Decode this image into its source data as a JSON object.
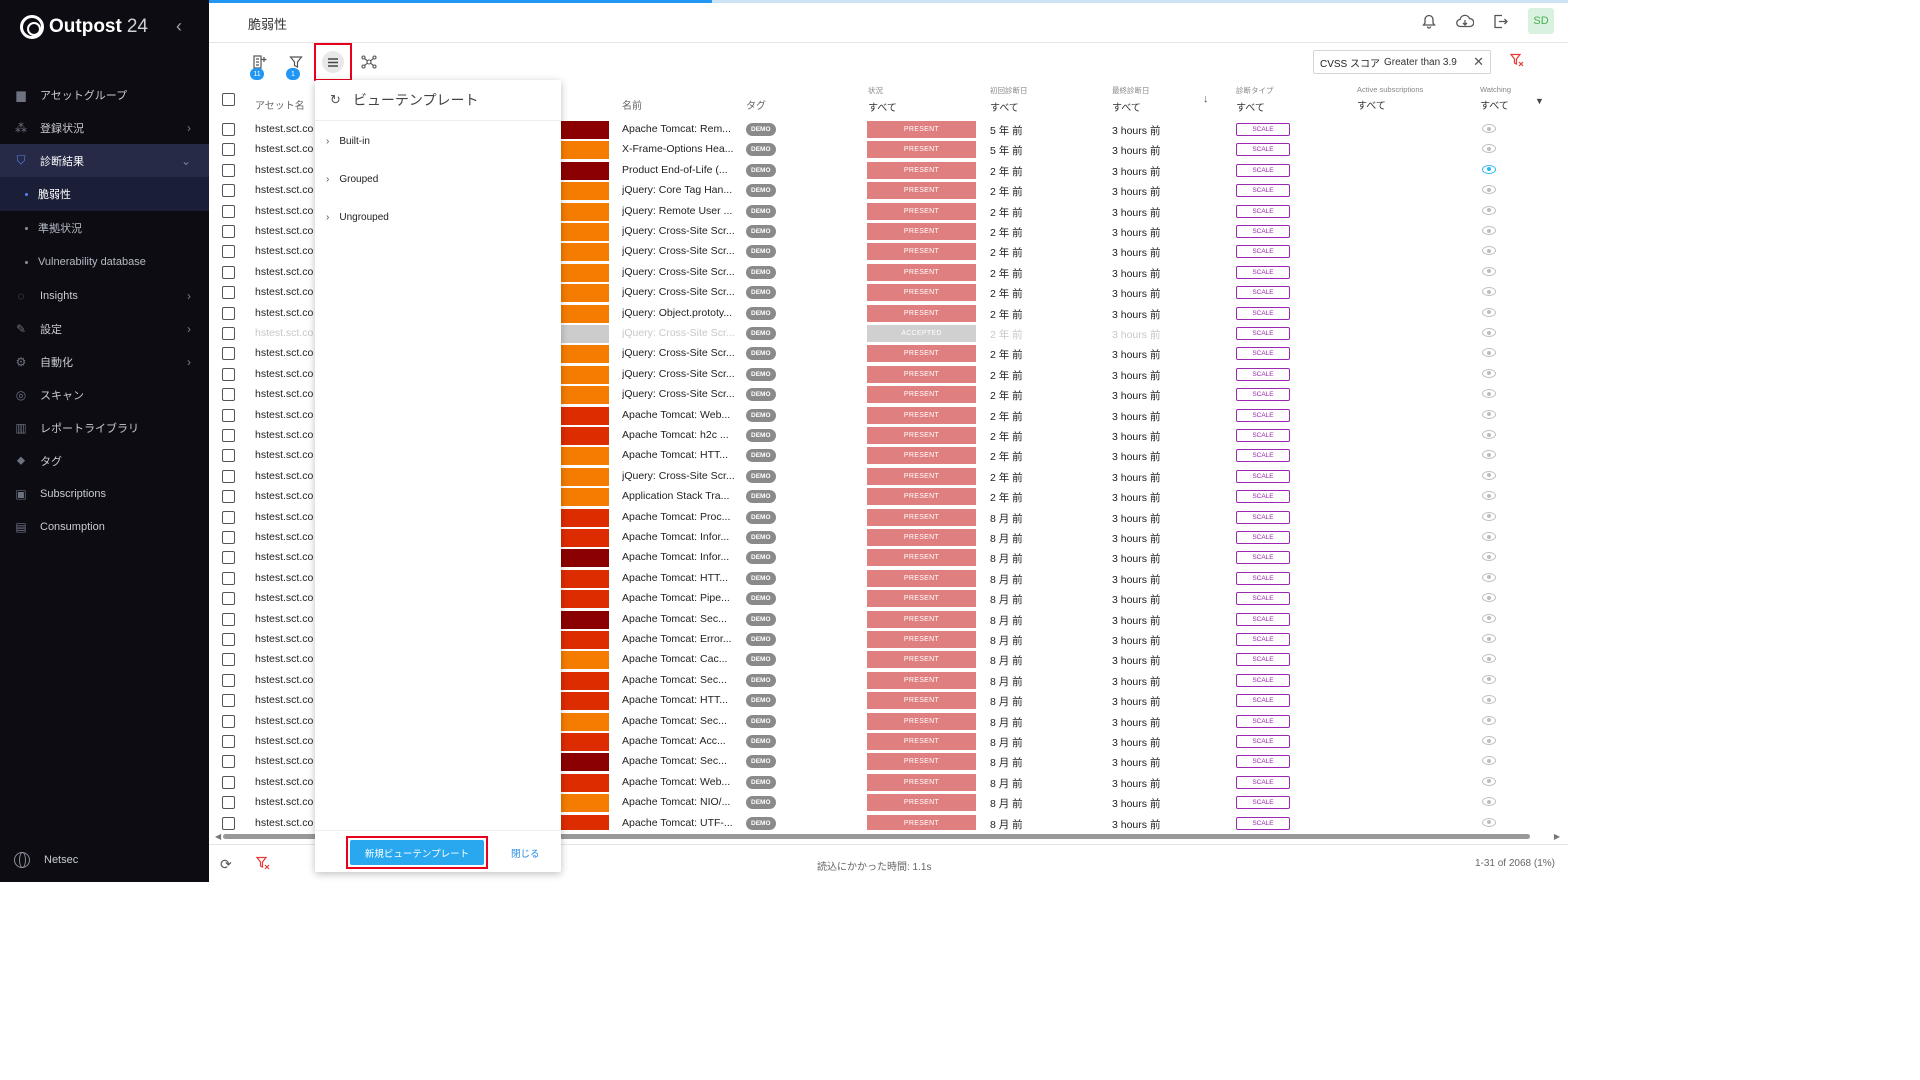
{
  "app": {
    "brand": "Outpost",
    "brand_suffix": "24"
  },
  "sidebar": {
    "items": [
      {
        "label": "アセットグループ",
        "icon": "folder-icon",
        "chevron": false
      },
      {
        "label": "登録状況",
        "icon": "network-icon",
        "chevron": true
      },
      {
        "label": "診断結果",
        "icon": "shield-icon",
        "chevron": true,
        "active": true,
        "expanded": true
      },
      {
        "label": "脆弱性",
        "sub": true,
        "active": true
      },
      {
        "label": "準拠状況",
        "sub": true
      },
      {
        "label": "Vulnerability database",
        "sub": true
      },
      {
        "label": "Insights",
        "icon": "bulb-icon",
        "chevron": true
      },
      {
        "label": "設定",
        "icon": "wrench-icon",
        "chevron": true
      },
      {
        "label": "自動化",
        "icon": "automation-icon",
        "chevron": true
      },
      {
        "label": "スキャン",
        "icon": "scan-icon",
        "chevron": false
      },
      {
        "label": "レポートライブラリ",
        "icon": "library-icon",
        "chevron": false
      },
      {
        "label": "タグ",
        "icon": "tag-icon",
        "chevron": false
      },
      {
        "label": "Subscriptions",
        "icon": "subscriptions-icon",
        "chevron": false
      },
      {
        "label": "Consumption",
        "icon": "consumption-icon",
        "chevron": false
      }
    ],
    "org": "Netsec"
  },
  "header": {
    "title": "脆弱性",
    "progress": 0.37,
    "avatar": "SD"
  },
  "toolbar": {
    "asset_badge": "11",
    "filter_badge": "1",
    "filter_chip": {
      "field": "CVSS スコア",
      "value": "Greater than 3.9"
    }
  },
  "columns": {
    "asset": "アセット名",
    "name": "名前",
    "tags": "タグ",
    "status": {
      "label": "状況",
      "filter": "すべて"
    },
    "first_seen": {
      "label": "初回診断日",
      "filter": "すべて"
    },
    "last_seen": {
      "label": "最終診断日",
      "filter": "すべて"
    },
    "scan_type": {
      "label": "診断タイプ",
      "filter": "すべて"
    },
    "subscriptions": {
      "label": "Active subscriptions",
      "filter": "すべて"
    },
    "watching": {
      "label": "Watching",
      "filter": "すべて"
    }
  },
  "rows": [
    {
      "asset": "hstest.sct.co",
      "sev": "#8b0000",
      "name": "Apache Tomcat: Rem...",
      "tag": "DEMO",
      "status": "PRESENT",
      "first": "5 年 前",
      "last": "3 hours 前",
      "type": "SCALE",
      "watch": false
    },
    {
      "asset": "hstest.sct.co",
      "sev": "#f57c00",
      "name": "X-Frame-Options Hea...",
      "tag": "DEMO",
      "status": "PRESENT",
      "first": "5 年 前",
      "last": "3 hours 前",
      "type": "SCALE",
      "watch": false
    },
    {
      "asset": "hstest.sct.co",
      "sev": "#8b0000",
      "name": "Product End-of-Life (...",
      "tag": "DEMO",
      "status": "PRESENT",
      "first": "2 年 前",
      "last": "3 hours 前",
      "type": "SCALE",
      "watch": true
    },
    {
      "asset": "hstest.sct.co",
      "sev": "#f57c00",
      "name": "jQuery: Core Tag Han...",
      "tag": "DEMO",
      "status": "PRESENT",
      "first": "2 年 前",
      "last": "3 hours 前",
      "type": "SCALE",
      "watch": false
    },
    {
      "asset": "hstest.sct.co",
      "sev": "#f57c00",
      "name": "jQuery: Remote User ...",
      "tag": "DEMO",
      "status": "PRESENT",
      "first": "2 年 前",
      "last": "3 hours 前",
      "type": "SCALE",
      "watch": false
    },
    {
      "asset": "hstest.sct.co",
      "sev": "#f57c00",
      "name": "jQuery: Cross-Site Scr...",
      "tag": "DEMO",
      "status": "PRESENT",
      "first": "2 年 前",
      "last": "3 hours 前",
      "type": "SCALE",
      "watch": false
    },
    {
      "asset": "hstest.sct.co",
      "sev": "#f57c00",
      "name": "jQuery: Cross-Site Scr...",
      "tag": "DEMO",
      "status": "PRESENT",
      "first": "2 年 前",
      "last": "3 hours 前",
      "type": "SCALE",
      "watch": false
    },
    {
      "asset": "hstest.sct.co",
      "sev": "#f57c00",
      "name": "jQuery: Cross-Site Scr...",
      "tag": "DEMO",
      "status": "PRESENT",
      "first": "2 年 前",
      "last": "3 hours 前",
      "type": "SCALE",
      "watch": false
    },
    {
      "asset": "hstest.sct.co",
      "sev": "#f57c00",
      "name": "jQuery: Cross-Site Scr...",
      "tag": "DEMO",
      "status": "PRESENT",
      "first": "2 年 前",
      "last": "3 hours 前",
      "type": "SCALE",
      "watch": false
    },
    {
      "asset": "hstest.sct.co",
      "sev": "#f57c00",
      "name": "jQuery: Object.prototy...",
      "tag": "DEMO",
      "status": "PRESENT",
      "first": "2 年 前",
      "last": "3 hours 前",
      "type": "SCALE",
      "watch": false
    },
    {
      "asset": "hstest.sct.co",
      "sev": "#cccccc",
      "name": "jQuery: Cross-Site Scr...",
      "tag": "DEMO",
      "status": "ACCEPTED",
      "first": "2 年 前",
      "last": "3 hours 前",
      "type": "SCALE",
      "watch": false,
      "dim": true
    },
    {
      "asset": "hstest.sct.co",
      "sev": "#f57c00",
      "name": "jQuery: Cross-Site Scr...",
      "tag": "DEMO",
      "status": "PRESENT",
      "first": "2 年 前",
      "last": "3 hours 前",
      "type": "SCALE",
      "watch": false
    },
    {
      "asset": "hstest.sct.co",
      "sev": "#f57c00",
      "name": "jQuery: Cross-Site Scr...",
      "tag": "DEMO",
      "status": "PRESENT",
      "first": "2 年 前",
      "last": "3 hours 前",
      "type": "SCALE",
      "watch": false
    },
    {
      "asset": "hstest.sct.co",
      "sev": "#f57c00",
      "name": "jQuery: Cross-Site Scr...",
      "tag": "DEMO",
      "status": "PRESENT",
      "first": "2 年 前",
      "last": "3 hours 前",
      "type": "SCALE",
      "watch": false
    },
    {
      "asset": "hstest.sct.co",
      "sev": "#dd2c00",
      "name": "Apache Tomcat: Web...",
      "tag": "DEMO",
      "status": "PRESENT",
      "first": "2 年 前",
      "last": "3 hours 前",
      "type": "SCALE",
      "watch": false
    },
    {
      "asset": "hstest.sct.co",
      "sev": "#dd2c00",
      "name": "Apache Tomcat: h2c ...",
      "tag": "DEMO",
      "status": "PRESENT",
      "first": "2 年 前",
      "last": "3 hours 前",
      "type": "SCALE",
      "watch": false
    },
    {
      "asset": "hstest.sct.co",
      "sev": "#f57c00",
      "name": "Apache Tomcat: HTT...",
      "tag": "DEMO",
      "status": "PRESENT",
      "first": "2 年 前",
      "last": "3 hours 前",
      "type": "SCALE",
      "watch": false
    },
    {
      "asset": "hstest.sct.co",
      "sev": "#f57c00",
      "name": "jQuery: Cross-Site Scr...",
      "tag": "DEMO",
      "status": "PRESENT",
      "first": "2 年 前",
      "last": "3 hours 前",
      "type": "SCALE",
      "watch": false
    },
    {
      "asset": "hstest.sct.co",
      "sev": "#f57c00",
      "name": "Application Stack Tra...",
      "tag": "DEMO",
      "status": "PRESENT",
      "first": "2 年 前",
      "last": "3 hours 前",
      "type": "SCALE",
      "watch": false
    },
    {
      "asset": "hstest.sct.co",
      "sev": "#dd2c00",
      "name": "Apache Tomcat: Proc...",
      "tag": "DEMO",
      "status": "PRESENT",
      "first": "8 月 前",
      "last": "3 hours 前",
      "type": "SCALE",
      "watch": false
    },
    {
      "asset": "hstest.sct.co",
      "sev": "#dd2c00",
      "name": "Apache Tomcat: Infor...",
      "tag": "DEMO",
      "status": "PRESENT",
      "first": "8 月 前",
      "last": "3 hours 前",
      "type": "SCALE",
      "watch": false
    },
    {
      "asset": "hstest.sct.co",
      "sev": "#8b0000",
      "name": "Apache Tomcat: Infor...",
      "tag": "DEMO",
      "status": "PRESENT",
      "first": "8 月 前",
      "last": "3 hours 前",
      "type": "SCALE",
      "watch": false
    },
    {
      "asset": "hstest.sct.co",
      "sev": "#dd2c00",
      "name": "Apache Tomcat: HTT...",
      "tag": "DEMO",
      "status": "PRESENT",
      "first": "8 月 前",
      "last": "3 hours 前",
      "type": "SCALE",
      "watch": false
    },
    {
      "asset": "hstest.sct.co",
      "sev": "#dd2c00",
      "name": "Apache Tomcat: Pipe...",
      "tag": "DEMO",
      "status": "PRESENT",
      "first": "8 月 前",
      "last": "3 hours 前",
      "type": "SCALE",
      "watch": false
    },
    {
      "asset": "hstest.sct.co",
      "sev": "#8b0000",
      "name": "Apache Tomcat: Sec...",
      "tag": "DEMO",
      "status": "PRESENT",
      "first": "8 月 前",
      "last": "3 hours 前",
      "type": "SCALE",
      "watch": false
    },
    {
      "asset": "hstest.sct.co",
      "sev": "#dd2c00",
      "name": "Apache Tomcat: Error...",
      "tag": "DEMO",
      "status": "PRESENT",
      "first": "8 月 前",
      "last": "3 hours 前",
      "type": "SCALE",
      "watch": false
    },
    {
      "asset": "hstest.sct.co",
      "sev": "#f57c00",
      "name": "Apache Tomcat: Cac...",
      "tag": "DEMO",
      "status": "PRESENT",
      "first": "8 月 前",
      "last": "3 hours 前",
      "type": "SCALE",
      "watch": false
    },
    {
      "asset": "hstest.sct.co",
      "sev": "#dd2c00",
      "name": "Apache Tomcat: Sec...",
      "tag": "DEMO",
      "status": "PRESENT",
      "first": "8 月 前",
      "last": "3 hours 前",
      "type": "SCALE",
      "watch": false
    },
    {
      "asset": "hstest.sct.co",
      "sev": "#dd2c00",
      "name": "Apache Tomcat: HTT...",
      "tag": "DEMO",
      "status": "PRESENT",
      "first": "8 月 前",
      "last": "3 hours 前",
      "type": "SCALE",
      "watch": false
    },
    {
      "asset": "hstest.sct.co",
      "sev": "#f57c00",
      "name": "Apache Tomcat: Sec...",
      "tag": "DEMO",
      "status": "PRESENT",
      "first": "8 月 前",
      "last": "3 hours 前",
      "type": "SCALE",
      "watch": false
    },
    {
      "asset": "hstest.sct.co",
      "sev": "#dd2c00",
      "name": "Apache Tomcat: Acc...",
      "tag": "DEMO",
      "status": "PRESENT",
      "first": "8 月 前",
      "last": "3 hours 前",
      "type": "SCALE",
      "watch": false
    },
    {
      "asset": "hstest.sct.co",
      "sev": "#8b0000",
      "name": "Apache Tomcat: Sec...",
      "tag": "DEMO",
      "status": "PRESENT",
      "first": "8 月 前",
      "last": "3 hours 前",
      "type": "SCALE",
      "watch": false
    },
    {
      "asset": "hstest.sct.co",
      "sev": "#dd2c00",
      "name": "Apache Tomcat: Web...",
      "tag": "DEMO",
      "status": "PRESENT",
      "first": "8 月 前",
      "last": "3 hours 前",
      "type": "SCALE",
      "watch": false
    },
    {
      "asset": "hstest.sct.co",
      "sev": "#f57c00",
      "name": "Apache Tomcat: NIO/...",
      "tag": "DEMO",
      "status": "PRESENT",
      "first": "8 月 前",
      "last": "3 hours 前",
      "type": "SCALE",
      "watch": false
    },
    {
      "asset": "hstest.sct.co",
      "sev": "#dd2c00",
      "name": "Apache Tomcat: UTF-...",
      "tag": "DEMO",
      "status": "PRESENT",
      "first": "8 月 前",
      "last": "3 hours 前",
      "type": "SCALE",
      "watch": false
    }
  ],
  "popup": {
    "title": "ビューテンプレート",
    "groups": [
      "Built-in",
      "Grouped",
      "Ungrouped"
    ],
    "new_button": "新規ビューテンプレート",
    "close_button": "閉じる"
  },
  "footer": {
    "load_time": "読込にかかった時間: 1.1s",
    "pagination": "1-31 of 2068 (1%)"
  }
}
